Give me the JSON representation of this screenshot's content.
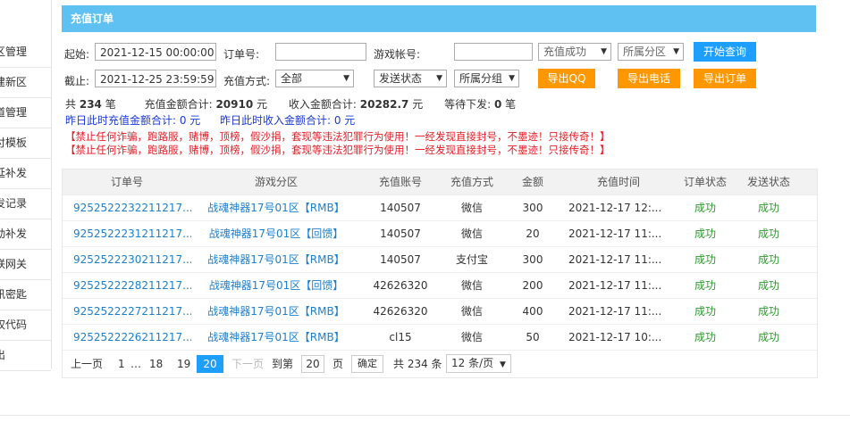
{
  "sidebar": {
    "items": [
      {
        "label": "区管理"
      },
      {
        "label": "建新区"
      },
      {
        "label": "道管理"
      },
      {
        "label": "付模板"
      },
      {
        "label": "延补发"
      },
      {
        "label": "发记录"
      },
      {
        "label": "动补发"
      },
      {
        "label": "联网关"
      },
      {
        "label": "讯密匙"
      },
      {
        "label": "权代码"
      },
      {
        "label": "出"
      }
    ]
  },
  "panel": {
    "title": "充值订单"
  },
  "filters": {
    "start_label": "起始:",
    "start_value": "2021-12-15 00:00:00",
    "order_no_label": "订单号:",
    "order_no_value": "",
    "game_account_label": "游戏帐号:",
    "game_account_value": "",
    "status_select": "充值成功",
    "zone_select": "所属分区",
    "search_button": "开始查询",
    "end_label": "截止:",
    "end_value": "2021-12-25 23:59:59",
    "method_label": "充值方式:",
    "method_select": "全部",
    "send_status_select": "发送状态",
    "group_select": "所属分组",
    "export_qq": "导出QQ",
    "export_phone": "导出电话",
    "export_order": "导出订单"
  },
  "stats": {
    "total_prefix": "共",
    "total_count": "234",
    "total_unit": "笔",
    "recharge_total_label": "充值金额合计:",
    "recharge_total_value": "20910",
    "recharge_unit": "元",
    "income_total_label": "收入金额合计:",
    "income_total_value": "20282.7",
    "income_unit": "元",
    "pending_label": "等待下发:",
    "pending_value": "0",
    "pending_unit": "笔",
    "yesterday_recharge": "昨日此时充值金额合计: 0 元",
    "yesterday_income": "昨日此时收入金额合计: 0 元",
    "warning_1": "【禁止任何诈骗，跑路服，赌博，顶榜，假沙捐，套现等违法犯罪行为使用！一经发现直接封号，不墨迹！只接传奇！】",
    "warning_2": "【禁止任何诈骗，跑路服，赌博，顶榜，假沙捐，套现等违法犯罪行为使用！一经发现直接封号，不墨迹！只接传奇！】"
  },
  "table": {
    "headers": [
      "订单号",
      "游戏分区",
      "充值账号",
      "充值方式",
      "金额",
      "充值时间",
      "订单状态",
      "发送状态"
    ],
    "rows": [
      {
        "order": "9252522232211217...",
        "zone": "战魂神器17号01区【RMB】",
        "account": "140507",
        "method": "微信",
        "amount": "300",
        "time": "2021-12-17 12:...",
        "order_status": "成功",
        "send_status": "成功"
      },
      {
        "order": "9252522231211217...",
        "zone": "战魂神器17号01区【回馈】",
        "account": "140507",
        "method": "微信",
        "amount": "20",
        "time": "2021-12-17 11:...",
        "order_status": "成功",
        "send_status": "成功"
      },
      {
        "order": "9252522230211217...",
        "zone": "战魂神器17号01区【RMB】",
        "account": "140507",
        "method": "支付宝",
        "amount": "300",
        "time": "2021-12-17 11:...",
        "order_status": "成功",
        "send_status": "成功"
      },
      {
        "order": "9252522228211217...",
        "zone": "战魂神器17号01区【回馈】",
        "account": "42626320",
        "method": "微信",
        "amount": "200",
        "time": "2021-12-17 11:...",
        "order_status": "成功",
        "send_status": "成功"
      },
      {
        "order": "9252522227211217...",
        "zone": "战魂神器17号01区【RMB】",
        "account": "42626320",
        "method": "微信",
        "amount": "400",
        "time": "2021-12-17 11:...",
        "order_status": "成功",
        "send_status": "成功"
      },
      {
        "order": "9252522226211217...",
        "zone": "战魂神器17号01区【RMB】",
        "account": "cl15",
        "method": "微信",
        "amount": "50",
        "time": "2021-12-17 10:...",
        "order_status": "成功",
        "send_status": "成功"
      }
    ]
  },
  "pager": {
    "prev": "上一页",
    "p1": "1",
    "ellipsis": "…",
    "p18": "18",
    "p19": "19",
    "current": "20",
    "next": "下一页",
    "goto_label": "到第",
    "goto_value": "20",
    "page_unit": "页",
    "confirm": "确定",
    "total_text": "共 234 条",
    "page_size": "12 条/页"
  },
  "colors": {
    "header_blue": "#5fc0f2",
    "button_blue": "#1e9fff",
    "button_orange": "#ff9800",
    "warning_red": "#e51c23",
    "success_green": "#2e9b2e"
  }
}
